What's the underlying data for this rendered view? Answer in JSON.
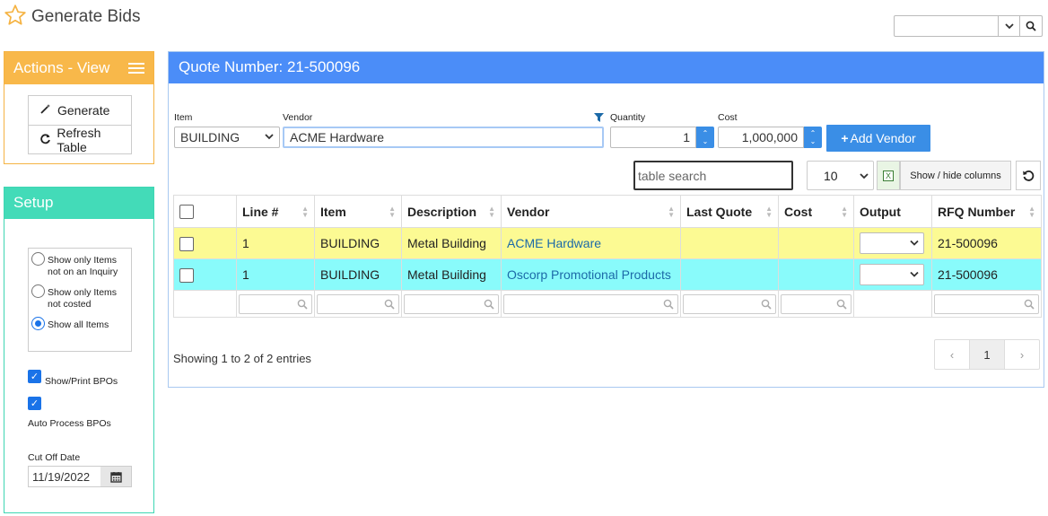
{
  "header": {
    "title": "Generate Bids"
  },
  "actions": {
    "title": "Actions - View",
    "buttons": [
      {
        "label": "Generate",
        "icon": "magic-wand-icon"
      },
      {
        "label": "Refresh Table",
        "icon": "refresh-icon"
      }
    ]
  },
  "setup": {
    "title": "Setup",
    "radios": [
      {
        "label": "Show only Items not on an Inquiry",
        "checked": false
      },
      {
        "label": "Show only Items not costed",
        "checked": false
      },
      {
        "label": "Show all Items",
        "checked": true
      }
    ],
    "show_print_bpos": {
      "label": "Show/Print BPOs",
      "checked": true
    },
    "auto_process_bpos": {
      "label": "Auto Process BPOs",
      "checked": true
    },
    "cutoff": {
      "label": "Cut Off Date",
      "value": "11/19/2022"
    }
  },
  "main": {
    "title": "Quote Number: 21-500096",
    "item": {
      "label": "Item",
      "value": "BUILDING"
    },
    "vendor": {
      "label": "Vendor",
      "value": "ACME Hardware"
    },
    "quantity": {
      "label": "Quantity",
      "value": "1"
    },
    "cost": {
      "label": "Cost",
      "value": "1,000,000"
    },
    "add_vendor_label": "Add Vendor",
    "search_placeholder": "table search",
    "page_size": "10",
    "show_hide_label": "Show / hide columns",
    "columns": [
      "Line #",
      "Item",
      "Description",
      "Vendor",
      "Last Quote",
      "Cost",
      "Output",
      "RFQ Number"
    ],
    "rows": [
      {
        "line": "1",
        "item": "BUILDING",
        "description": "Metal Building",
        "vendor": "ACME Hardware",
        "last_quote": "",
        "cost": "",
        "output": "",
        "rfq": "21-500096",
        "color": "#fcfa93"
      },
      {
        "line": "1",
        "item": "BUILDING",
        "description": "Metal Building",
        "vendor": "Oscorp Promotional Products",
        "last_quote": "",
        "cost": "",
        "output": "",
        "rfq": "21-500096",
        "color": "#89fbfb"
      }
    ],
    "entries_info": "Showing 1 to 2 of 2 entries",
    "pager": {
      "prev": "‹",
      "current": "1",
      "next": "›"
    }
  }
}
